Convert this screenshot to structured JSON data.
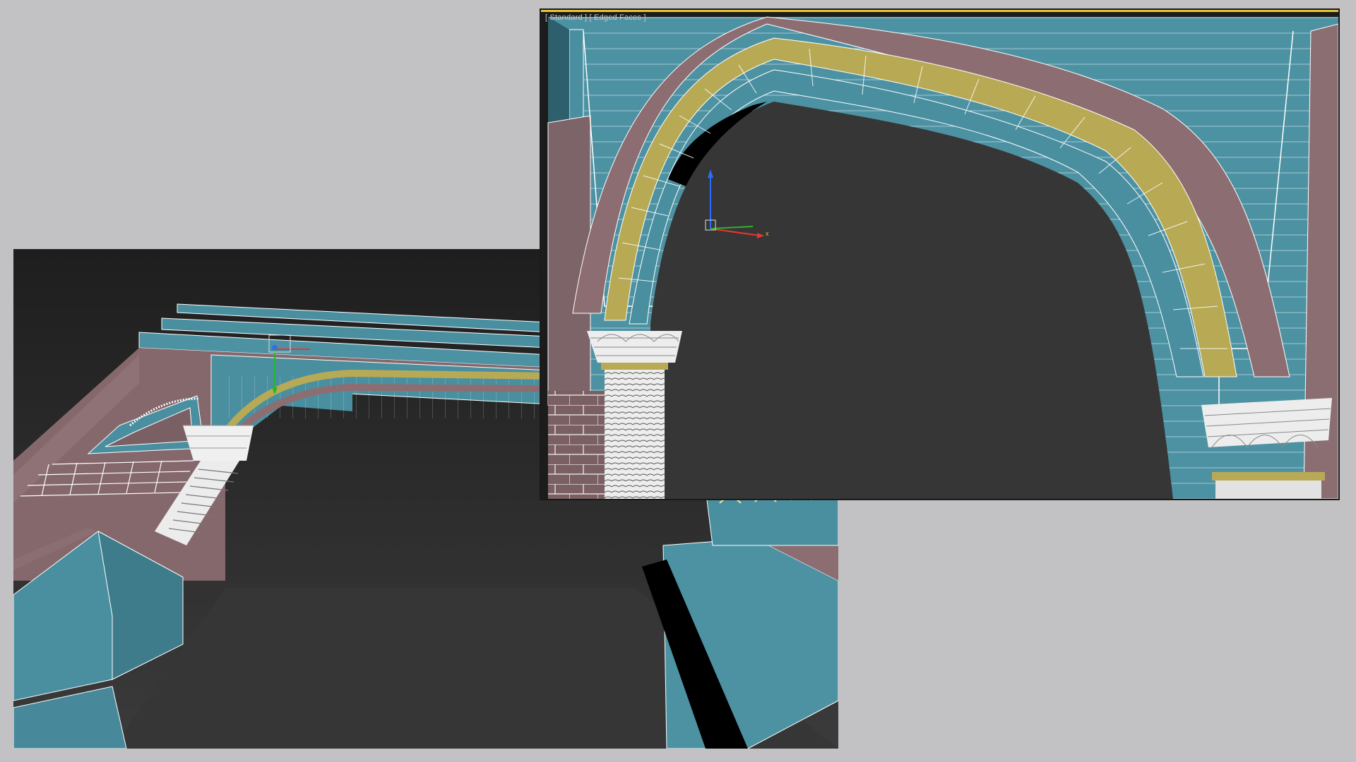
{
  "viewports": {
    "left": {
      "label_shading": "",
      "label_mode": ""
    },
    "right": {
      "label_shading": "[ Standard ]",
      "label_mode": "[ Edged Faces ]"
    }
  },
  "gizmo": {
    "x_label": "x",
    "y_label": "y",
    "z_label": "z"
  },
  "colors": {
    "background": "#c2c2c4",
    "viewport_bg": "#2e2e2e",
    "teal_stone": "#4a8fa0",
    "pink_stone": "#8c6e72",
    "yellow_band": "#b8aa55",
    "wire": "#ffffff",
    "active_border": "#e5c53a"
  }
}
